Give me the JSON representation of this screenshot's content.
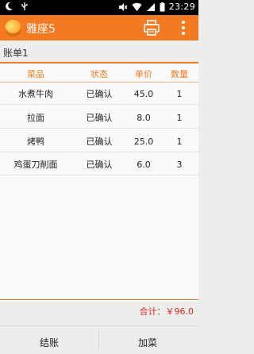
{
  "status_bar": {
    "time": "23:29",
    "icons": [
      "moon-icon",
      "usb-icon",
      "mute-icon",
      "wifi-icon",
      "signal-icon",
      "battery-icon"
    ]
  },
  "action_bar": {
    "title": "雅座5",
    "icons": [
      "app-logo-icon",
      "printer-icon",
      "overflow-menu-icon"
    ]
  },
  "bill": {
    "title": "账单1"
  },
  "table": {
    "headers": [
      "菜品",
      "状态",
      "单价",
      "数量"
    ],
    "rows": [
      [
        "水煮牛肉",
        "已确认",
        "45.0",
        "1"
      ],
      [
        "拉面",
        "已确认",
        "8.0",
        "1"
      ],
      [
        "烤鸭",
        "已确认",
        "25.0",
        "1"
      ],
      [
        "鸡蛋刀削面",
        "已确认",
        "6.0",
        "3"
      ]
    ]
  },
  "total": "合计：￥96.0",
  "bottom_actions": {
    "checkout": "结账",
    "add_dish": "加菜"
  },
  "colors": {
    "accent": "#f47a21",
    "total_red": "#e0281f"
  }
}
